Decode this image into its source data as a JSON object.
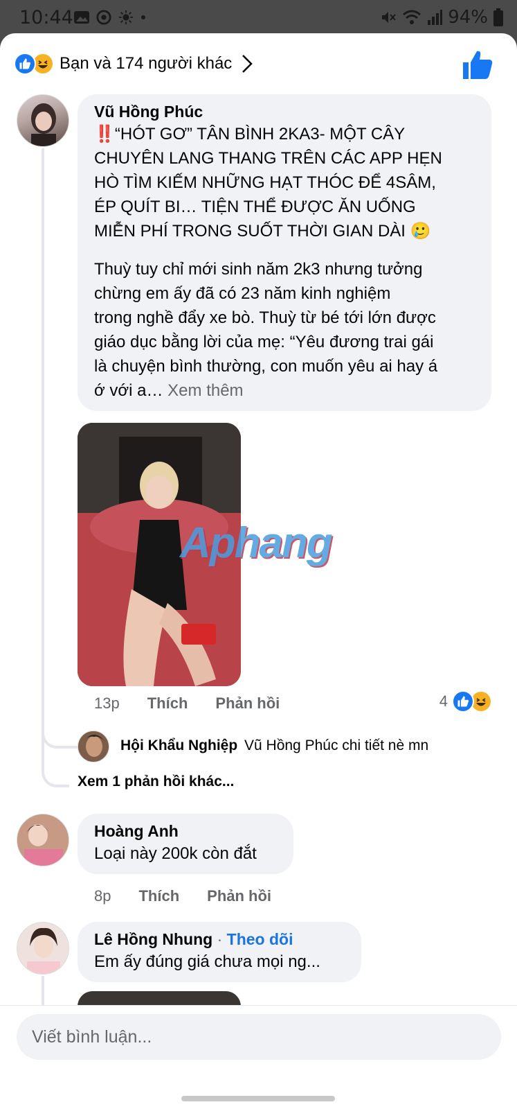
{
  "status_bar": {
    "time": "10:44",
    "battery": "94%"
  },
  "header": {
    "reactions_text": "Bạn và 174 người khác"
  },
  "comments": [
    {
      "name": "Vũ Hồng Phúc",
      "text_lines": [
        "‼️“HÓT GƠ” TÂN BÌNH 2KA3- MỘT CÂY",
        "CHUYÊN LANG THANG TRÊN CÁC APP HẸN",
        "HÒ TÌM KIẾM NHỮNG HẠT THÓC ĐỂ 4SÂM,",
        "ÉP QUÍT BI… TIỆN THỂ ĐƯỢC ĂN UỐNG",
        "MIỄN PHÍ TRONG SUỐT THỜI GIAN DÀI 🥲"
      ],
      "body_lines": [
        "Thuỳ tuy chỉ mới sinh năm 2k3 nhưng tưởng",
        "chừng em ấy đã có 23 năm kinh nghiệm",
        "trong nghề đẩy xe bò. Thuỳ từ bé tới lớn được",
        "giáo dục bằng lời của mẹ: “Yêu đương trai gái",
        "là chuyện bình thường, con muốn yêu ai hay á",
        "ớ với a…"
      ],
      "see_more": "Xem thêm",
      "watermark": "Aphang",
      "time": "13p",
      "like": "Thích",
      "reply": "Phản hồi",
      "reaction_count": "4",
      "reply_preview": {
        "name": "Hội Khẩu Nghiệp",
        "text": "Vũ Hồng Phúc chi tiết nè mn"
      },
      "more_replies": "Xem 1 phản hồi khác..."
    },
    {
      "name": "Hoàng Anh",
      "text": "Loại này 200k còn đắt",
      "time": "8p",
      "like": "Thích",
      "reply": "Phản hồi"
    },
    {
      "name": "Lê Hồng Nhung",
      "separator": "·",
      "follow": "Theo dõi",
      "text": "Em ấy đúng giá chưa mọi ng..."
    }
  ],
  "composer": {
    "placeholder": "Viết bình luận..."
  },
  "colors": {
    "accent": "#1877f2",
    "bubble": "#f0f2f5",
    "muted": "#65676b",
    "haha": "#f7b125"
  },
  "icons": [
    "photo-icon",
    "messenger-icon",
    "brightness-icon",
    "mute-icon",
    "wifi-icon",
    "signal-icon",
    "battery-icon",
    "like-icon",
    "haha-icon",
    "chevron-right-icon"
  ]
}
